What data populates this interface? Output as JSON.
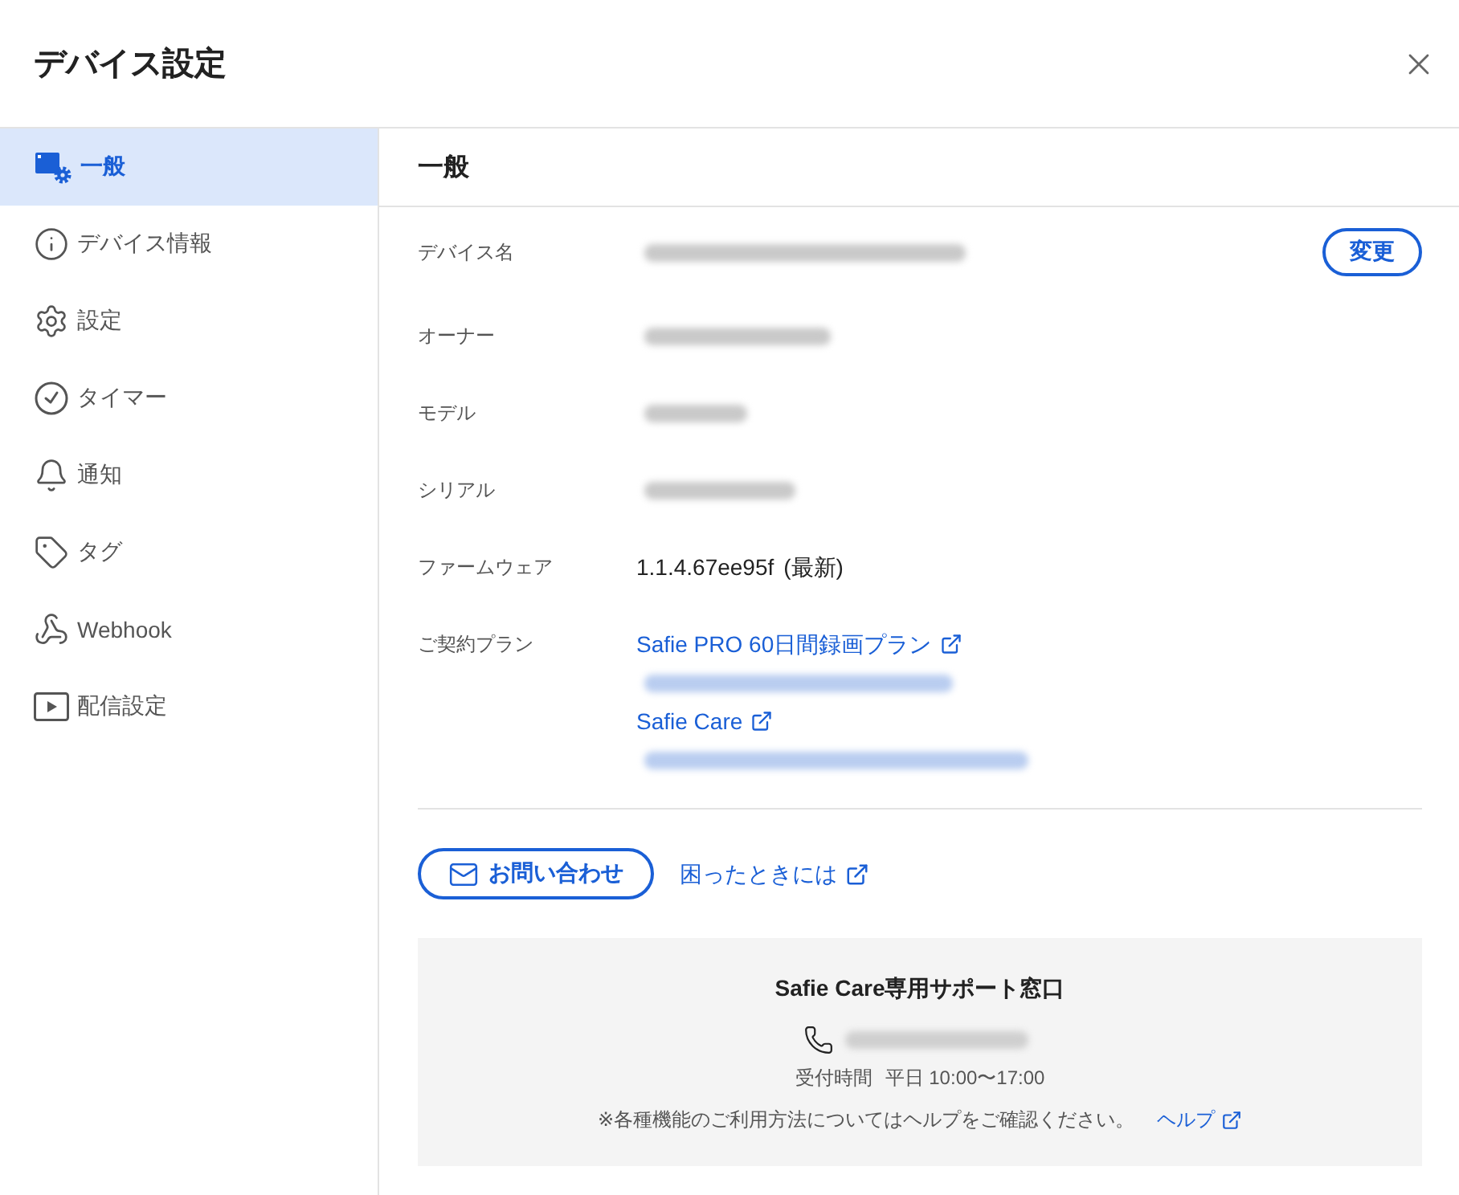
{
  "window": {
    "title": "デバイス設定"
  },
  "sidebar": {
    "items": [
      {
        "label": "一般",
        "selected": true
      },
      {
        "label": "デバイス情報",
        "selected": false
      },
      {
        "label": "設定",
        "selected": false
      },
      {
        "label": "タイマー",
        "selected": false
      },
      {
        "label": "通知",
        "selected": false
      },
      {
        "label": "タグ",
        "selected": false
      },
      {
        "label": "Webhook",
        "selected": false
      },
      {
        "label": "配信設定",
        "selected": false
      }
    ]
  },
  "section": {
    "title": "一般"
  },
  "details": [
    {
      "label": "デバイス名",
      "kind": "redacted",
      "button": "変更"
    },
    {
      "label": "オーナー",
      "kind": "redacted"
    },
    {
      "label": "モデル",
      "kind": "redacted"
    },
    {
      "label": "シリアル",
      "kind": "redacted"
    },
    {
      "label": "ファームウェア",
      "kind": "text",
      "value": "1.1.4.67ee95f",
      "note": "(最新)"
    },
    {
      "label": "ご契約プラン",
      "kind": "links",
      "links": [
        {
          "kind": "link",
          "text": "Safie PRO 60日間録画プラン"
        },
        {
          "kind": "redacted"
        },
        {
          "kind": "link",
          "text": "Safie Care"
        },
        {
          "kind": "redacted"
        }
      ]
    }
  ],
  "actions": {
    "contact_button": "お問い合わせ",
    "help_link": "困ったときには"
  },
  "support": {
    "title": "Safie Care専用サポート窓口",
    "phone": {
      "kind": "redacted"
    },
    "hours_label": "受付時間",
    "hours": "平日 10:00〜17:00",
    "note": "※各種機能のご利用方法についてはヘルプをご確認ください。",
    "help_link": "ヘルプ"
  }
}
